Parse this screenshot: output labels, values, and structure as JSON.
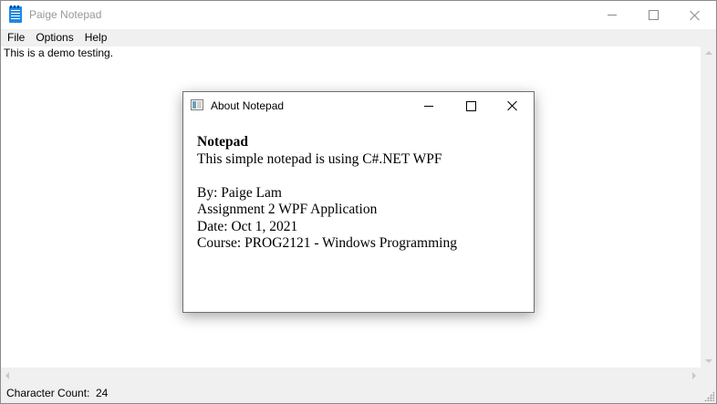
{
  "window": {
    "title": "Paige Notepad"
  },
  "menu": {
    "items": [
      "File",
      "Options",
      "Help"
    ]
  },
  "editor": {
    "text": "This is a demo testing."
  },
  "status": {
    "label": "Character Count:",
    "value": "24"
  },
  "dialog": {
    "title": "About Notepad",
    "heading": "Notepad",
    "description": "This simple notepad is using C#.NET WPF",
    "author": "By: Paige Lam",
    "assignment": "Assignment 2 WPF Application",
    "date": "Date: Oct 1, 2021",
    "course": "Course: PROG2121 - Windows Programming"
  },
  "icons": {
    "app": "notepad-icon",
    "dialog_app": "window-icon",
    "minimize": "minimize-icon",
    "maximize": "maximize-icon",
    "close": "close-icon"
  },
  "colors": {
    "menubar_bg": "#f0f0f0",
    "app_icon": "#1e88e5",
    "inactive_title": "#999999"
  }
}
